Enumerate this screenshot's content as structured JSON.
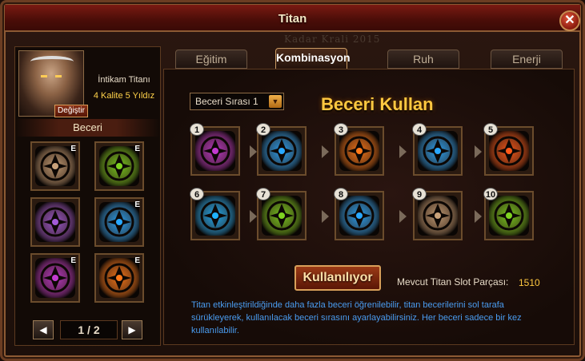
{
  "window": {
    "title": "Titan",
    "close_label": "✕",
    "watermark": "Kadar Krali 2015"
  },
  "titan": {
    "name": "İntikam Titanı",
    "quality": "4 Kalite 5 Yıldız",
    "change_label": "Değiştir"
  },
  "left_panel": {
    "skills_header": "Beceri",
    "skills": [
      {
        "icon": "tan-totem-glyph",
        "badge": "E",
        "color": "#c9a27a"
      },
      {
        "icon": "green-wing-glyph",
        "badge": "E",
        "color": "#7ed321"
      },
      {
        "icon": "purple-spider-glyph",
        "badge": "",
        "color": "#a25bd8"
      },
      {
        "icon": "blue-sun-glyph",
        "badge": "E",
        "color": "#2aa8ff"
      },
      {
        "icon": "purple-skull-glyph",
        "badge": "E",
        "color": "#c23ad0"
      },
      {
        "icon": "orange-lightning-glyph",
        "badge": "E",
        "color": "#ff7a1a"
      }
    ],
    "pager": {
      "prev": "◀",
      "text": "1 / 2",
      "next": "▶"
    }
  },
  "tabs": [
    {
      "label": "Eğitim",
      "active": false
    },
    {
      "label": "Kombinasyon",
      "active": true
    },
    {
      "label": "Ruh",
      "active": false
    },
    {
      "label": "Enerji",
      "active": false
    }
  ],
  "main": {
    "order_select": {
      "label": "Beceri Sırası 1",
      "arrow": "▼"
    },
    "title": "Beceri Kullan",
    "sequence": [
      {
        "num": "1",
        "icon": "purple-spider-glyph",
        "color": "#c23ad0"
      },
      {
        "num": "2",
        "icon": "blue-crest-glyph",
        "color": "#2aa8ff"
      },
      {
        "num": "3",
        "icon": "orange-lightning-glyph",
        "color": "#ff7a1a"
      },
      {
        "num": "4",
        "icon": "blue-sun-glyph",
        "color": "#2aa8ff"
      },
      {
        "num": "5",
        "icon": "orange-flame-glyph",
        "color": "#ff5a1a"
      },
      {
        "num": "6",
        "icon": "blue-rune-glyph",
        "color": "#1fb2ff"
      },
      {
        "num": "7",
        "icon": "green-swirl-glyph",
        "color": "#7ed321"
      },
      {
        "num": "8",
        "icon": "blue-spiral-glyph",
        "color": "#2aa8ff"
      },
      {
        "num": "9",
        "icon": "tan-totem-glyph",
        "color": "#c9a27a"
      },
      {
        "num": "10",
        "icon": "green-wing-glyph",
        "color": "#7ed321"
      }
    ],
    "in_use_label": "Kullanılıyor",
    "slot_label": "Mevcut Titan Slot Parçası:",
    "slot_value": "1510",
    "info_text": "Titan etkinleştirildiğinde daha fazla beceri öğrenilebilir, titan becerilerini sol tarafa sürükleyerek, kullanılacak beceri sırasını ayarlayabilirsiniz. Her beceri sadece bir kez kullanılabilir."
  }
}
